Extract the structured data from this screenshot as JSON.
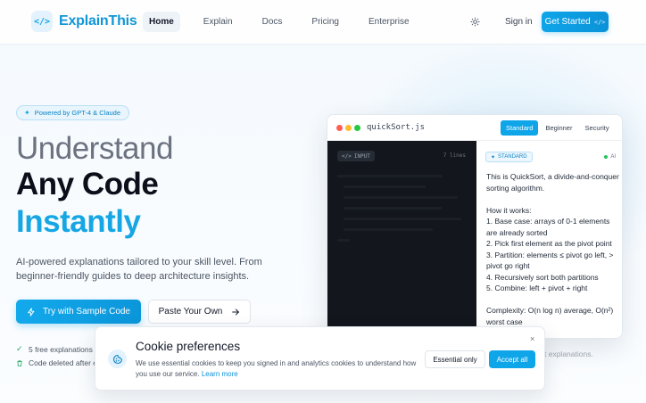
{
  "header": {
    "logo_icon": "</>",
    "brand": "ExplainThis",
    "nav": [
      {
        "label": "Home",
        "active": true
      },
      {
        "label": "Explain",
        "active": false
      },
      {
        "label": "Docs",
        "active": false
      },
      {
        "label": "Pricing",
        "active": false
      },
      {
        "label": "Enterprise",
        "active": false
      }
    ],
    "theme_icon": "sun-icon",
    "signin": "Sign in",
    "cta": "Get Started",
    "cta_icon": "</>"
  },
  "hero": {
    "badge": "Powered by GPT-4 & Claude",
    "title_line1": "Understand",
    "title_line2": "Any Code",
    "title_line3": "Instantly",
    "description": "AI-powered explanations tailored to your skill level. From beginner-friendly guides to deep architecture insights.",
    "primary_button": "Try with Sample Code",
    "secondary_button": "Paste Your Own",
    "features": [
      "5 free explanations",
      "Code deleted after e"
    ]
  },
  "demo": {
    "file": "quickSort.js",
    "levels": [
      "Standard",
      "Beginner",
      "Security"
    ],
    "active_level": "Standard",
    "input_label": "INPUT",
    "input_meta": "7 lines",
    "output_label": "STANDARD",
    "ai_label": "AI",
    "explanation": "This is QuickSort, a divide-and-conquer sorting algorithm.\n\nHow it works:\n1. Base case: arrays of 0-1 elements are already sorted\n2. Pick first element as the pivot point\n3. Partition: elements ≤ pivot go left, > pivot go right\n4. Recursively sort both partitions\n5. Combine: left + pivot + right\n\nComplexity: O(n log n) average, O(n²) worst case",
    "behind_text": "t explanations."
  },
  "cookie": {
    "title": "Cookie preferences",
    "description": "We use essential cookies to keep you signed in and analytics cookies to understand how you use our service.",
    "link": "Learn more",
    "essential_button": "Essential only",
    "accept_button": "Accept all",
    "close": "×"
  },
  "colors": {
    "accent": "#0ea5e9",
    "brand_text": "#1196d6",
    "instantly": "#17a6e4",
    "code_bg": "#13171d"
  }
}
